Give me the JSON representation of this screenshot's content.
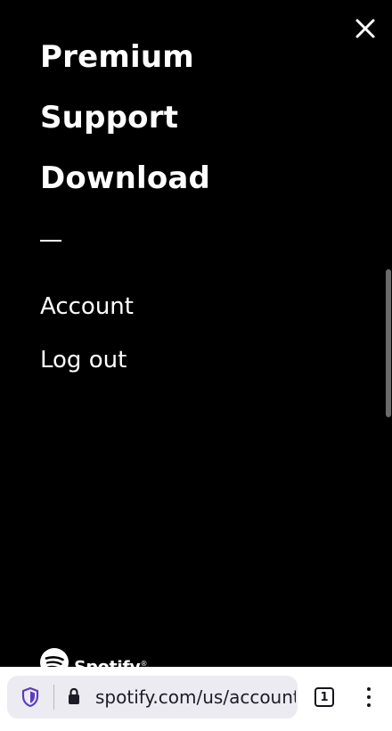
{
  "menu": {
    "primary_items": [
      {
        "label": "Premium"
      },
      {
        "label": "Support"
      },
      {
        "label": "Download"
      }
    ],
    "secondary_items": [
      {
        "label": "Account"
      },
      {
        "label": "Log out"
      }
    ],
    "close_icon": "close-icon"
  },
  "footer": {
    "logo_text": "Spotify",
    "logo_mark": "®"
  },
  "browser": {
    "url": "spotify.com/us/account/overview/",
    "tab_count": "1",
    "shield_icon": "tracking-protection-shield-icon",
    "lock_icon": "lock-icon",
    "menu_icon": "kebab-menu-icon"
  },
  "colors": {
    "background": "#000000",
    "text": "#ffffff",
    "toolbar": "#ffffff",
    "url_field": "#ecebf1",
    "shield_accent": "#5b3dbe"
  }
}
